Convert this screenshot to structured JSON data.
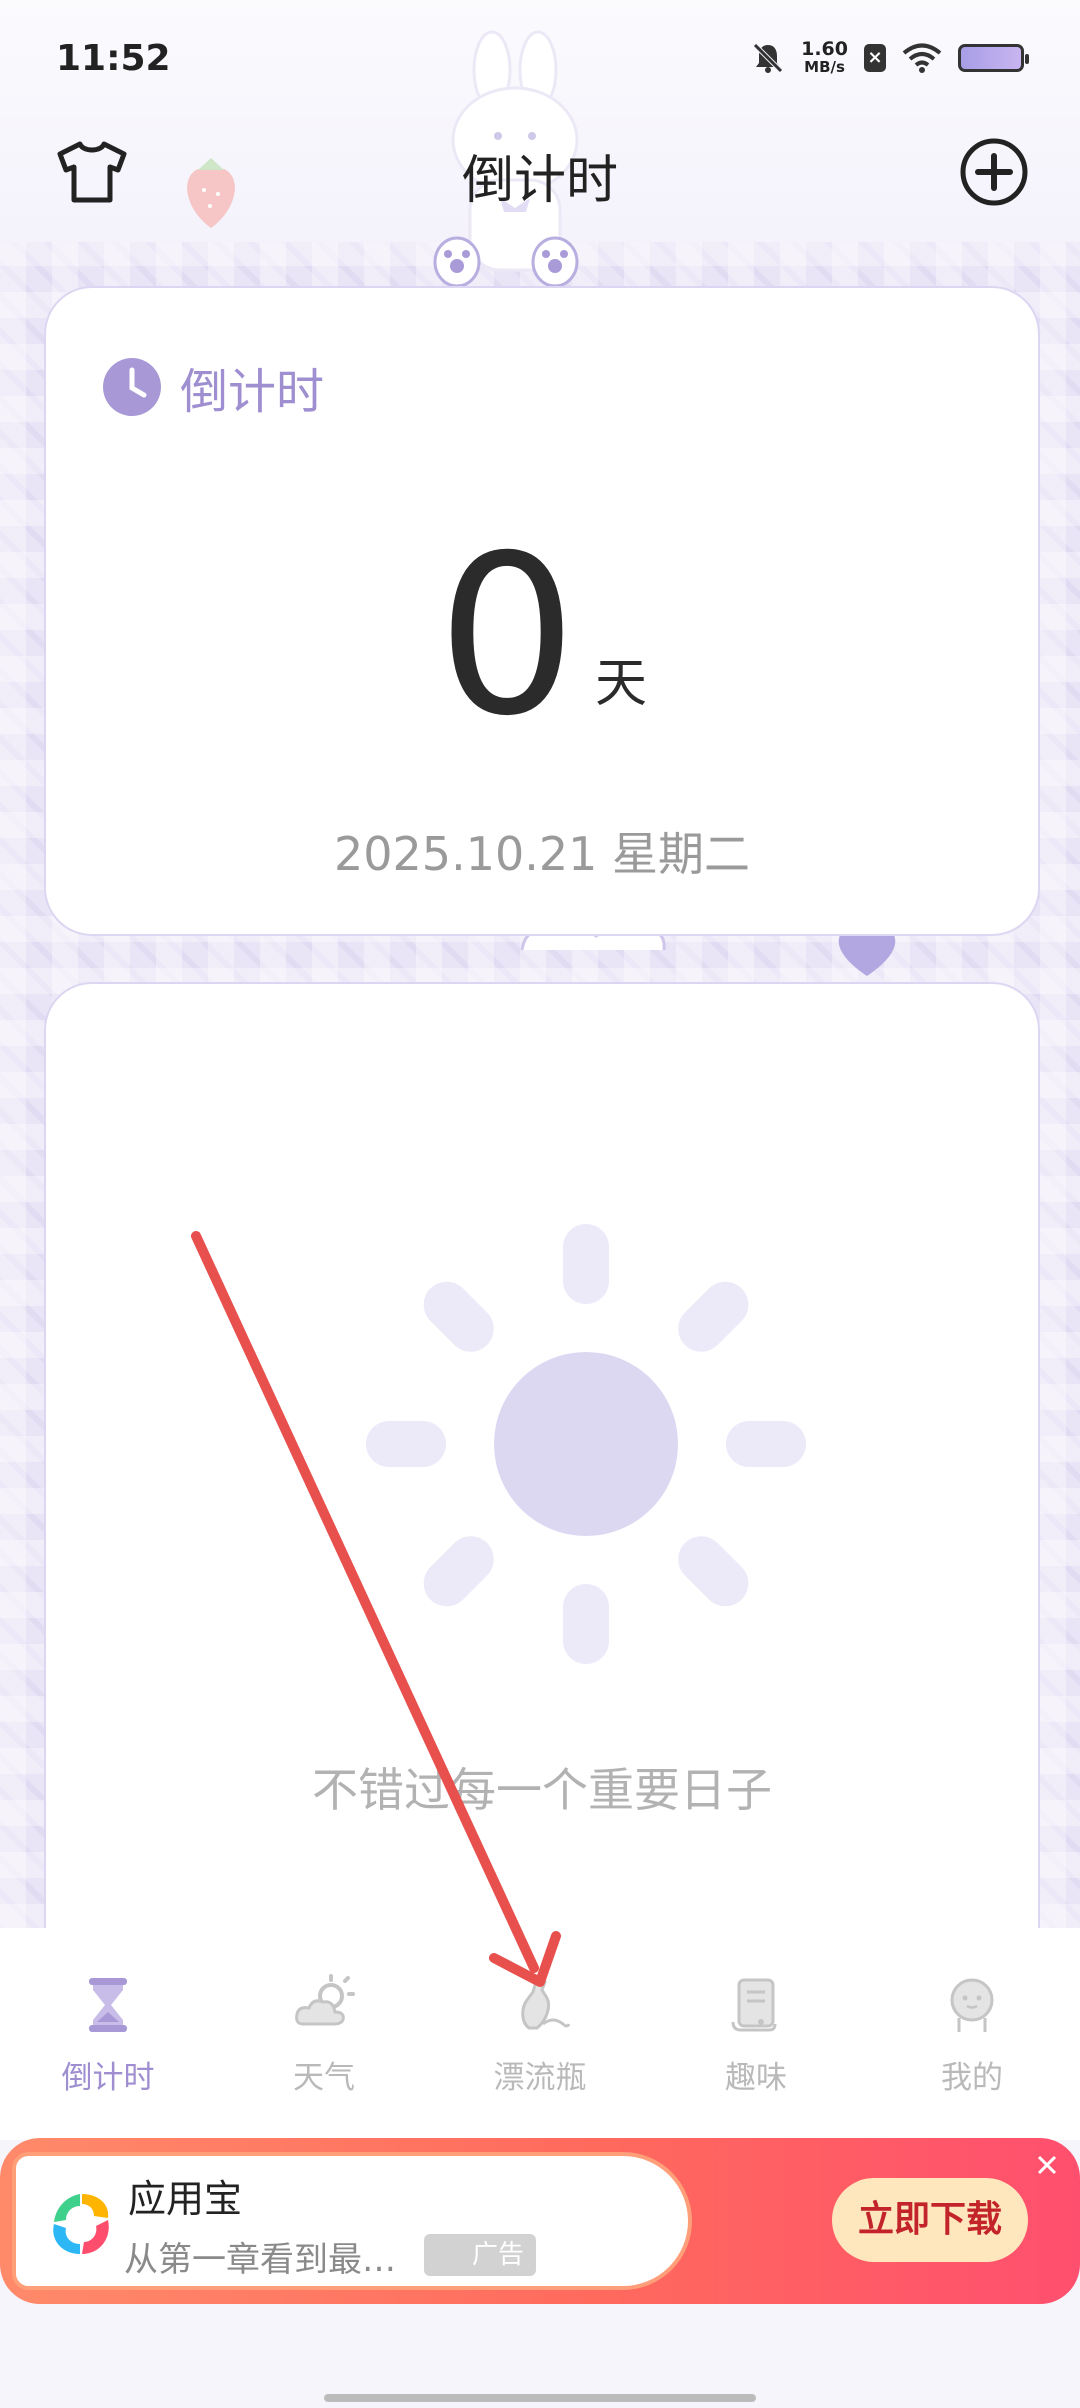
{
  "status_bar": {
    "time": "11:52",
    "net_speed_value": "1.60",
    "net_speed_unit": "MB/s",
    "icons": [
      "bell-muted-icon",
      "x-badge-icon",
      "wifi-icon",
      "battery-icon"
    ]
  },
  "header": {
    "title": "倒计时",
    "left_icon": "t-shirt-icon",
    "right_icon": "add-circle-icon"
  },
  "countdown_card": {
    "label": "倒计时",
    "icon": "clock-icon",
    "days_value": "0",
    "days_unit": "天",
    "date": "2025.10.21 星期二"
  },
  "empty_card": {
    "icon": "sun-icon",
    "slogan": "不错过每一个重要日子"
  },
  "tabs": [
    {
      "label": "倒计时",
      "icon": "hourglass-icon",
      "active": true
    },
    {
      "label": "天气",
      "icon": "weather-icon",
      "active": false
    },
    {
      "label": "漂流瓶",
      "icon": "bottle-icon",
      "active": false
    },
    {
      "label": "趣味",
      "icon": "scroll-icon",
      "active": false
    },
    {
      "label": "我的",
      "icon": "profile-face-icon",
      "active": false
    }
  ],
  "ad": {
    "title": "应用宝",
    "description": "从第一章看到最…",
    "tag": "广告",
    "cta": "立即下载"
  },
  "colors": {
    "accent": "#9f8fd0",
    "sun": "#ddd8f2",
    "ad_gradient_start": "#ff8a6a",
    "ad_gradient_end": "#ff4f6e",
    "arrow": "#e8504e"
  }
}
